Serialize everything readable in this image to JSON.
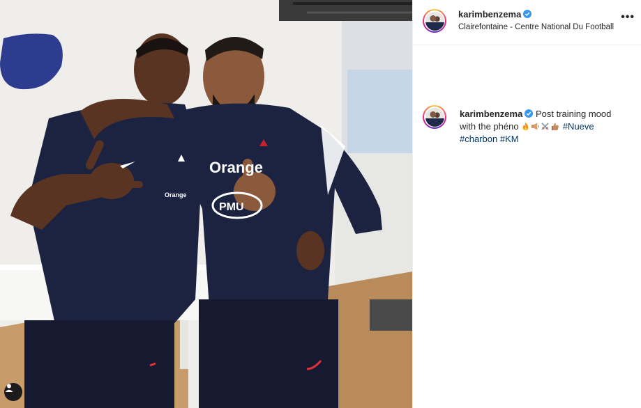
{
  "post": {
    "username": "karimbenzema",
    "verified": true,
    "location": "Clairefontaine - Centre National Du Football",
    "more_label": "•••"
  },
  "caption": {
    "username": "karimbenzema",
    "text": "Post training mood with the phéno",
    "emojis": [
      "fire-emoji",
      "speaker-emoji",
      "crossed-swords-emoji",
      "thumbs-up-emoji"
    ],
    "hashtags": [
      "#Nueve",
      "#charbon",
      "#KM"
    ]
  },
  "photo": {
    "shirt_text_left": "Orange",
    "shirt_text_right": "Orange",
    "badge_icon": "person-tag-icon"
  },
  "colors": {
    "hashtag": "#00376b",
    "verified": "#3897f0",
    "kit": "#1b2340"
  }
}
